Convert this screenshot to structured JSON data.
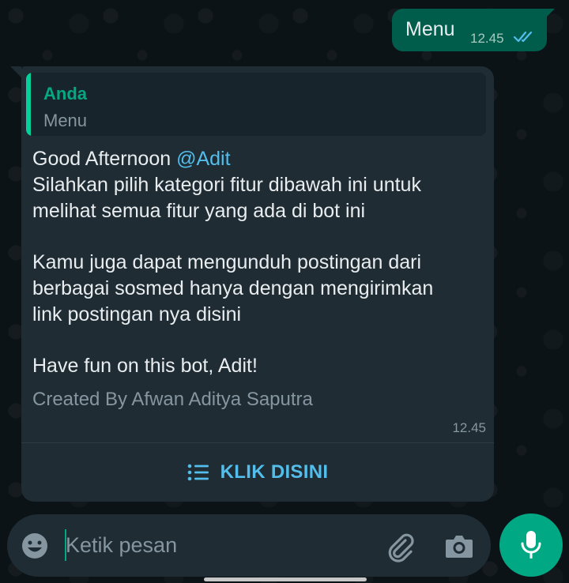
{
  "outgoing": {
    "text": "Menu",
    "time": "12.45",
    "status_icon": "double-check-read-icon"
  },
  "incoming": {
    "quote": {
      "author": "Anda",
      "text": "Menu"
    },
    "lines": {
      "greeting": "Good Afternoon ",
      "mention": "@Adit",
      "line2": "Silahkan pilih kategori fitur dibawah ini untuk",
      "line3": "melihat semua fitur yang ada di bot ini",
      "line4": "Kamu juga dapat mengunduh postingan dari",
      "line5": "berbagai sosmed hanya dengan mengirimkan",
      "line6": "link postingan nya disini",
      "line7": "Have fun on this bot, Adit!"
    },
    "footer": "Created By Afwan Aditya Saputra",
    "time": "12.45",
    "button_label": "KLIK DISINI",
    "button_icon": "list-icon"
  },
  "composer": {
    "placeholder": "Ketik pesan",
    "value": "",
    "icons": [
      "emoji-icon",
      "attach-icon",
      "camera-icon",
      "mic-icon"
    ]
  },
  "colors": {
    "background": "#0b141a",
    "outgoing_bubble": "#005c4b",
    "incoming_bubble": "#1f2c34",
    "accent": "#00a884",
    "link": "#53bdeb"
  }
}
